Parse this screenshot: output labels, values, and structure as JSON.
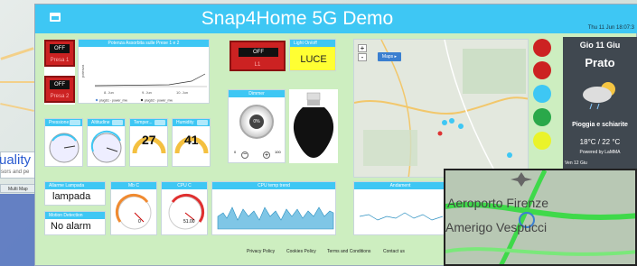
{
  "background": {
    "left_snippet_1": "uality",
    "left_snippet_2": "sors and pe",
    "left_snippet_3": "Multi Map"
  },
  "header": {
    "title": "Snap4Home 5G Demo",
    "date": "Thu 11 Jun 18:07:3"
  },
  "switches": [
    {
      "lcd": "OFF",
      "label": "Presa 1"
    },
    {
      "lcd": "OFF",
      "label": "Presa 2"
    }
  ],
  "power_chart": {
    "title": "Potenza Assorbita sulle Prese 1 e 2",
    "ylabel": "potenza",
    "xticks": [
      "8. Jun",
      "9. Jun",
      "10. Jun"
    ],
    "legend": [
      "plugS1 - power_mw",
      "plugS2 - power_mw"
    ]
  },
  "light_switch": {
    "lcd": "OFF",
    "label": "L1"
  },
  "light_onoff": {
    "title": "Light On/off",
    "value": "LUCE"
  },
  "dimmer": {
    "title": "Dimmer",
    "value": "0%",
    "min": "0",
    "max": "100"
  },
  "gauges": [
    {
      "title": "Pressione",
      "value": ""
    },
    {
      "title": "Altitudine",
      "value": ""
    },
    {
      "title": "Temper...",
      "value": "27"
    },
    {
      "title": "Humidity",
      "value": "41"
    }
  ],
  "allarme": {
    "title": "Allarme Lampada",
    "value": "lampada"
  },
  "motion": {
    "title": "Motion Detection",
    "value": "No alarm"
  },
  "cpu_gauges": [
    {
      "title": "Mb C",
      "value": "0"
    },
    {
      "title": "CPU C",
      "value": "51.00"
    }
  ],
  "cpu_trend": {
    "title": "CPU temp trend"
  },
  "andamento": {
    "title": "Andament"
  },
  "map": {
    "zoom_in": "+",
    "zoom_out": "-",
    "maps_button": "Maps ▸"
  },
  "weather": {
    "day": "Gio 11 Giu",
    "city": "Prato",
    "desc": "Pioggia e schiarite",
    "temps": "18°C / 22 °C",
    "powered": "Powered by LaMMA",
    "footer": "Ven 12 Giu"
  },
  "traffic_map": {
    "line1": "Aeroporto Firenze",
    "line2": "Amerigo Vespucci"
  },
  "footer_links": [
    "Privacy Policy",
    "Cookies Policy",
    "Terms and Conditions",
    "Contact us"
  ],
  "colors": {
    "accent": "#3ec7f4",
    "dashboard_bg": "#cdeec0",
    "switch_red": "#cc2222",
    "light_yellow": "#ffff33"
  }
}
